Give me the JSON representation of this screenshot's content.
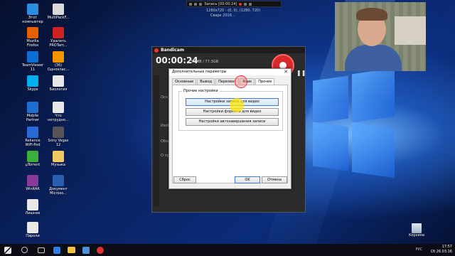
{
  "desktop_icons": [
    {
      "label": "Этот\nкомпьютер",
      "color": "#2b8fe0"
    },
    {
      "label": "MultiPackF...",
      "color": "#d9d9d9"
    },
    {
      "label": "Mozilla\nFirefox",
      "color": "#e66000"
    },
    {
      "label": "Удалить\nPROTam...",
      "color": "#c22"
    },
    {
      "label": "TeamViewer\n11",
      "color": "#0e6ed6"
    },
    {
      "label": "(36)\nОдноклас...",
      "color": "#f29400"
    },
    {
      "label": "Skype",
      "color": "#00aff0"
    },
    {
      "label": "Биология",
      "color": "#e8e8e8"
    },
    {
      "label": "Mobile\nPartner",
      "color": "#1c6fd1"
    },
    {
      "label": "Что\nнетрудно...",
      "color": "#e8e8e8"
    },
    {
      "label": "Reliance\nWiFi-Pod",
      "color": "#2a6ad6"
    },
    {
      "label": "Sony Vegas\n12",
      "color": "#555"
    },
    {
      "label": "μTorrent",
      "color": "#3cae3c"
    },
    {
      "label": "Музыка",
      "color": "#f0c860"
    },
    {
      "label": "WinRAR",
      "color": "#8a3a9a"
    },
    {
      "label": "Документ\nMicroso...",
      "color": "#2a5fb0"
    },
    {
      "label": "Лишнее",
      "color": "#e8e8e8"
    },
    {
      "label": "Пароли",
      "color": "#e8e8e8"
    }
  ],
  "recording_bar": {
    "status": "Запись [00:00:24]",
    "sub1": "1280x720 - (0, 0), (1280, 720)",
    "sub2": "Сварк 2016..."
  },
  "bandicam": {
    "title": "Bandicam",
    "timer": "00:00:24",
    "size": "3.3MB / 77.3GB",
    "rows": [
      "Осн",
      "Изобр",
      "Обзор р",
      "О прог"
    ]
  },
  "dialog": {
    "title": "Дополнительные параметры",
    "close": "✕",
    "tabs": [
      "Основные",
      "Вывод",
      "Перехват",
      "Язык",
      "Прочие"
    ],
    "active_tab": "Прочие",
    "group_label": "Прочие настройки",
    "buttons": {
      "record_settings": "Настройки записи для видео",
      "format_settings": "Настройки формата для видео",
      "autocomplete_settings": "Настройки автозавершения записи"
    },
    "reset": "Сброс",
    "ok": "OK",
    "cancel": "Отмена"
  },
  "recycle_bin": {
    "label": "Корзина"
  },
  "taskbar": {
    "time": "17:57",
    "date": "Сб 26.03.16",
    "lang": "РУС",
    "icons": [
      "windows-logo",
      "search",
      "task-view",
      "edge",
      "explorer",
      "store",
      "bandicam"
    ]
  }
}
